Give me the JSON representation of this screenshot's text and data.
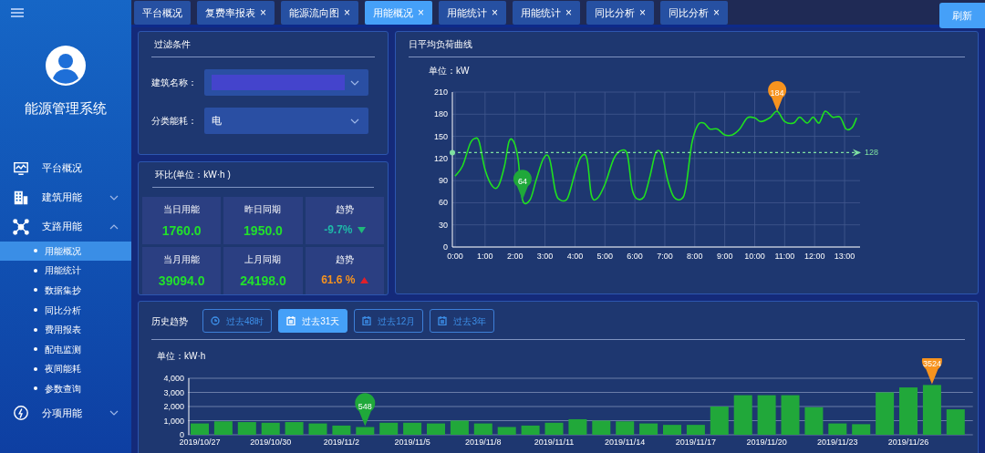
{
  "sidebar": {
    "app_title": "能源管理系统",
    "items": [
      {
        "label": "平台概况",
        "selected": false
      },
      {
        "label": "建筑用能",
        "expanded": false,
        "selected": false
      },
      {
        "label": "支路用能",
        "expanded": true,
        "selected": false,
        "children": [
          {
            "label": "用能概况",
            "selected": true
          },
          {
            "label": "用能统计",
            "selected": false
          },
          {
            "label": "数据集抄",
            "selected": false
          },
          {
            "label": "同比分析",
            "selected": false
          },
          {
            "label": "费用报表",
            "selected": false
          },
          {
            "label": "配电监测",
            "selected": false
          },
          {
            "label": "夜间能耗",
            "selected": false
          },
          {
            "label": "参数查询",
            "selected": false
          }
        ]
      },
      {
        "label": "分项用能",
        "expanded": false,
        "selected": false
      }
    ]
  },
  "tabs": [
    {
      "label": "平台概况",
      "selected": false,
      "closable": false
    },
    {
      "label": "复费率报表",
      "selected": false,
      "closable": true
    },
    {
      "label": "能源流向图",
      "selected": false,
      "closable": true
    },
    {
      "label": "用能概况",
      "selected": true,
      "closable": true
    },
    {
      "label": "用能统计",
      "selected": false,
      "closable": true
    },
    {
      "label": "用能统计",
      "selected": false,
      "closable": true
    },
    {
      "label": "同比分析",
      "selected": false,
      "closable": true
    },
    {
      "label": "同比分析",
      "selected": false,
      "closable": true
    }
  ],
  "close_glyph": "×",
  "refresh_button": "刷新",
  "filter": {
    "title": "过滤条件",
    "fields": [
      {
        "label": "建筑名称：",
        "redacted": true
      },
      {
        "label": "分类能耗：",
        "value": "电",
        "redacted": false
      }
    ]
  },
  "comparison": {
    "title": "环比(单位：kW·h )",
    "cells": [
      {
        "label": "当日用能",
        "value": "1760.0",
        "kind": "value"
      },
      {
        "label": "昨日同期",
        "value": "1950.0",
        "kind": "value"
      },
      {
        "label": "趋势",
        "value": "-9.7%",
        "kind": "down"
      },
      {
        "label": "当月用能",
        "value": "39094.0",
        "kind": "value"
      },
      {
        "label": "上月同期",
        "value": "24198.0",
        "kind": "value"
      },
      {
        "label": "趋势",
        "value": "61.6 %",
        "kind": "up"
      }
    ]
  },
  "load_curve": {
    "title": "日平均负荷曲线",
    "unit": "单位：kW",
    "chart_data": {
      "type": "line",
      "x": [
        0,
        0.25,
        0.5,
        0.65,
        0.8,
        1,
        1.25,
        1.45,
        1.65,
        1.8,
        1.95,
        2.1,
        2.25,
        2.5,
        2.7,
        2.95,
        3.15,
        3.35,
        3.5,
        3.75,
        4,
        4.2,
        4.4,
        4.55,
        4.75,
        5,
        5.3,
        5.55,
        5.75,
        5.9,
        6.05,
        6.3,
        6.5,
        6.7,
        6.9,
        7.1,
        7.3,
        7.55,
        7.7,
        7.9,
        8.1,
        8.3,
        8.5,
        8.75,
        9,
        9.25,
        9.5,
        9.75,
        10,
        10.2,
        10.5,
        10.75,
        11,
        11.3,
        11.5,
        11.75,
        11.95,
        12.15,
        12.35,
        12.6,
        12.85,
        13.05,
        13.25,
        13.4
      ],
      "series": [
        {
          "color": "#1fe01f",
          "values": [
            96,
            110,
            140,
            147,
            143,
            105,
            82,
            83,
            110,
            143,
            143,
            120,
            64,
            64,
            90,
            120,
            120,
            75,
            64,
            66,
            100,
            122,
            120,
            70,
            66,
            85,
            120,
            131,
            125,
            80,
            66,
            68,
            95,
            128,
            125,
            90,
            68,
            65,
            80,
            140,
            165,
            168,
            160,
            160,
            152,
            152,
            160,
            175,
            175,
            170,
            175,
            184,
            170,
            168,
            176,
            168,
            176,
            168,
            184,
            176,
            176,
            160,
            162,
            175
          ]
        }
      ],
      "xlim": [
        0,
        13.6
      ],
      "ylim": [
        0,
        210
      ],
      "yticks": [
        0,
        30,
        60,
        90,
        120,
        150,
        180,
        210
      ],
      "grid": true,
      "xticks": [
        {
          "value": 0,
          "label": "0:00"
        },
        {
          "value": 1,
          "label": "1:00"
        },
        {
          "value": 2,
          "label": "2:00"
        },
        {
          "value": 3,
          "label": "3:00"
        },
        {
          "value": 4,
          "label": "4:00"
        },
        {
          "value": 5,
          "label": "5:00"
        },
        {
          "value": 6,
          "label": "6:00"
        },
        {
          "value": 7,
          "label": "7:00"
        },
        {
          "value": 8,
          "label": "8:00"
        },
        {
          "value": 9,
          "label": "9:00"
        },
        {
          "value": 10,
          "label": "10:00"
        },
        {
          "value": 11,
          "label": "11:00"
        },
        {
          "value": 12,
          "label": "12:00"
        },
        {
          "value": 13,
          "label": "13:00"
        }
      ],
      "ref_lines": [
        {
          "axis": "y",
          "value": 128,
          "label": "128"
        }
      ],
      "annotations": [
        {
          "text": "184",
          "x": 10.75,
          "y": 184
        },
        {
          "text": "64",
          "x": 2.25,
          "y": 64
        }
      ]
    }
  },
  "history": {
    "title": "历史趋势",
    "ranges": [
      {
        "label": "过去48时",
        "selected": false
      },
      {
        "label": "过去31天",
        "selected": true
      },
      {
        "label": "过去12月",
        "selected": false
      },
      {
        "label": "过去3年",
        "selected": false
      }
    ],
    "unit": "单位：kW·h",
    "chart_data": {
      "type": "bar",
      "categories": [
        "2019/10/27",
        null,
        null,
        "2019/10/30",
        null,
        null,
        "2019/11/2",
        null,
        null,
        "2019/11/5",
        null,
        null,
        "2019/11/8",
        null,
        null,
        "2019/11/11",
        null,
        null,
        "2019/11/14",
        null,
        null,
        "2019/11/17",
        null,
        null,
        "2019/11/20",
        null,
        null,
        "2019/11/23",
        null,
        null,
        "2019/11/26",
        null,
        null
      ],
      "series": [
        {
          "color": "#21a83a",
          "values": [
            800,
            950,
            900,
            850,
            900,
            800,
            650,
            548,
            850,
            850,
            800,
            1000,
            800,
            550,
            650,
            850,
            1100,
            1000,
            950,
            800,
            700,
            700,
            2000,
            2800,
            2800,
            2800,
            1950,
            800,
            750,
            3000,
            3350,
            3524,
            1800
          ]
        }
      ],
      "ylim": [
        0,
        4000
      ],
      "grid": true,
      "yticks": [
        {
          "value": 0,
          "label": "0"
        },
        {
          "value": 1000,
          "label": "1,000"
        },
        {
          "value": 2000,
          "label": "2,000"
        },
        {
          "value": 3000,
          "label": "3,000"
        },
        {
          "value": 4000,
          "label": "4,000"
        }
      ],
      "annotations": [
        "548",
        "3524"
      ]
    }
  }
}
